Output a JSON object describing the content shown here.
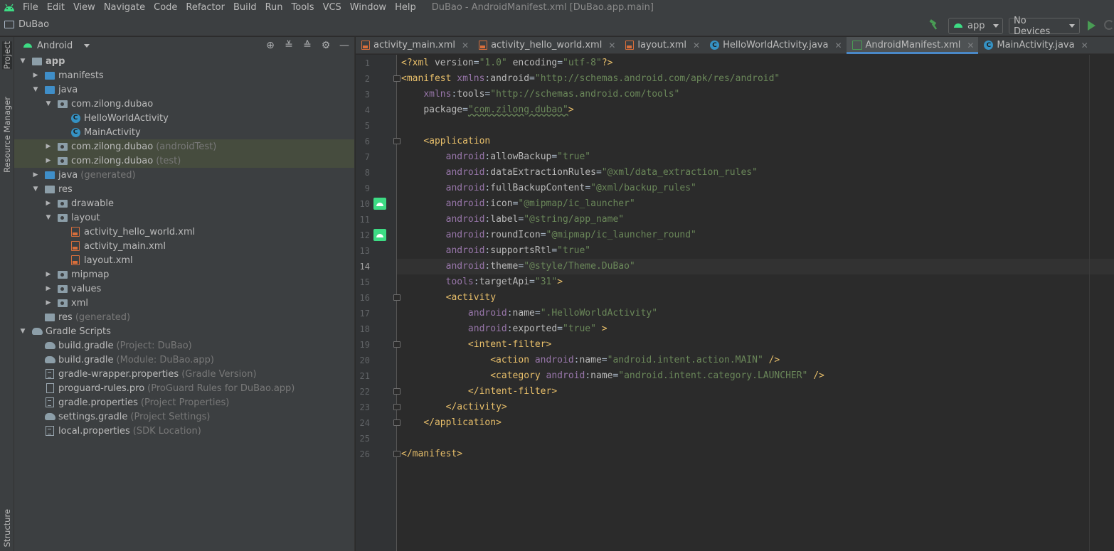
{
  "menubar": {
    "items": [
      "File",
      "Edit",
      "View",
      "Navigate",
      "Code",
      "Refactor",
      "Build",
      "Run",
      "Tools",
      "VCS",
      "Window",
      "Help"
    ],
    "window_title": "DuBao - AndroidManifest.xml [DuBao.app.main]"
  },
  "navbar": {
    "project_name": "DuBao",
    "run_config": "app",
    "device": "No Devices"
  },
  "side_tabs": {
    "project": "Project",
    "resource_manager": "Resource Manager",
    "structure": "Structure"
  },
  "project_panel": {
    "view_mode": "Android",
    "tree": [
      {
        "label": "app",
        "suffix": ""
      },
      {
        "label": "manifests",
        "suffix": ""
      },
      {
        "label": "java",
        "suffix": ""
      },
      {
        "label": "com.zilong.dubao",
        "suffix": ""
      },
      {
        "label": "HelloWorldActivity",
        "suffix": ""
      },
      {
        "label": "MainActivity",
        "suffix": ""
      },
      {
        "label": "com.zilong.dubao",
        "suffix": "(androidTest)"
      },
      {
        "label": "com.zilong.dubao",
        "suffix": "(test)"
      },
      {
        "label": "java",
        "suffix": "(generated)"
      },
      {
        "label": "res",
        "suffix": ""
      },
      {
        "label": "drawable",
        "suffix": ""
      },
      {
        "label": "layout",
        "suffix": ""
      },
      {
        "label": "activity_hello_world.xml",
        "suffix": ""
      },
      {
        "label": "activity_main.xml",
        "suffix": ""
      },
      {
        "label": "layout.xml",
        "suffix": ""
      },
      {
        "label": "mipmap",
        "suffix": ""
      },
      {
        "label": "values",
        "suffix": ""
      },
      {
        "label": "xml",
        "suffix": ""
      },
      {
        "label": "res",
        "suffix": "(generated)"
      },
      {
        "label": "Gradle Scripts",
        "suffix": ""
      },
      {
        "label": "build.gradle",
        "suffix": "(Project: DuBao)"
      },
      {
        "label": "build.gradle",
        "suffix": "(Module: DuBao.app)"
      },
      {
        "label": "gradle-wrapper.properties",
        "suffix": "(Gradle Version)"
      },
      {
        "label": "proguard-rules.pro",
        "suffix": "(ProGuard Rules for DuBao.app)"
      },
      {
        "label": "gradle.properties",
        "suffix": "(Project Properties)"
      },
      {
        "label": "settings.gradle",
        "suffix": "(Project Settings)"
      },
      {
        "label": "local.properties",
        "suffix": "(SDK Location)"
      }
    ]
  },
  "editor_tabs": [
    {
      "label": "activity_main.xml"
    },
    {
      "label": "activity_hello_world.xml"
    },
    {
      "label": "layout.xml"
    },
    {
      "label": "HelloWorldActivity.java"
    },
    {
      "label": "AndroidManifest.xml"
    },
    {
      "label": "MainActivity.java"
    }
  ],
  "editor": {
    "active_tab": "AndroidManifest.xml",
    "current_line": 14,
    "line_numbers": [
      "1",
      "2",
      "3",
      "4",
      "5",
      "6",
      "7",
      "8",
      "9",
      "10",
      "11",
      "12",
      "13",
      "14",
      "15",
      "16",
      "17",
      "18",
      "19",
      "20",
      "21",
      "22",
      "23",
      "24",
      "25",
      "26"
    ],
    "lines": [
      "<?xml version=\"1.0\" encoding=\"utf-8\"?>",
      "<manifest xmlns:android=\"http://schemas.android.com/apk/res/android\"",
      "    xmlns:tools=\"http://schemas.android.com/tools\"",
      "    package=\"com.zilong.dubao\">",
      "",
      "    <application",
      "        android:allowBackup=\"true\"",
      "        android:dataExtractionRules=\"@xml/data_extraction_rules\"",
      "        android:fullBackupContent=\"@xml/backup_rules\"",
      "        android:icon=\"@mipmap/ic_launcher\"",
      "        android:label=\"@string/app_name\"",
      "        android:roundIcon=\"@mipmap/ic_launcher_round\"",
      "        android:supportsRtl=\"true\"",
      "        android:theme=\"@style/Theme.DuBao\"",
      "        tools:targetApi=\"31\">",
      "        <activity",
      "            android:name=\".HelloWorldActivity\"",
      "            android:exported=\"true\" >",
      "            <intent-filter>",
      "                <action android:name=\"android.intent.action.MAIN\" />",
      "                <category android:name=\"android.intent.category.LAUNCHER\" />",
      "            </intent-filter>",
      "        </activity>",
      "    </application>",
      "",
      "</manifest>"
    ]
  }
}
